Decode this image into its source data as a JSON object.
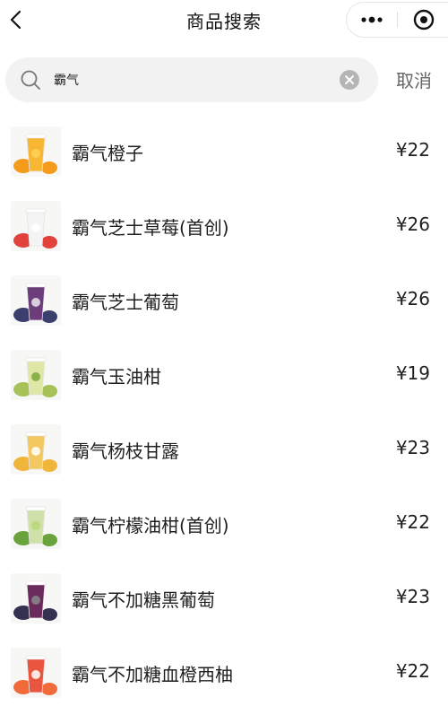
{
  "header": {
    "title": "商品搜索"
  },
  "search": {
    "value": "霸气",
    "cancel_label": "取消"
  },
  "products": [
    {
      "name": "霸气橙子",
      "price": "¥22",
      "cup": "#f7b733",
      "fruit": "#f59b1b",
      "fruit2": "#ffd35a"
    },
    {
      "name": "霸气芝士草莓(首创)",
      "price": "¥26",
      "cup": "#f4f4f4",
      "fruit": "#e2423b",
      "fruit2": "#ffffff"
    },
    {
      "name": "霸气芝士葡萄",
      "price": "¥26",
      "cup": "#6c3d7a",
      "fruit": "#3b3f6e",
      "fruit2": "#eae6ef"
    },
    {
      "name": "霸气玉油柑",
      "price": "¥19",
      "cup": "#dfe6a6",
      "fruit": "#a8c25a",
      "fruit2": "#7aa83a"
    },
    {
      "name": "霸气杨枝甘露",
      "price": "¥23",
      "cup": "#f3c860",
      "fruit": "#f0b53b",
      "fruit2": "#ffffff"
    },
    {
      "name": "霸气柠檬油柑(首创)",
      "price": "¥22",
      "cup": "#cfe0a8",
      "fruit": "#6aa33b",
      "fruit2": "#b9d67a"
    },
    {
      "name": "霸气不加糖黑葡萄",
      "price": "¥23",
      "cup": "#6b2a5c",
      "fruit": "#34304f",
      "fruit2": "#8a8a8a"
    },
    {
      "name": "霸气不加糖血橙西柚",
      "price": "¥22",
      "cup": "#e9553e",
      "fruit": "#f06a3a",
      "fruit2": "#ffffff"
    }
  ],
  "icons": {
    "back": "chevron-left-icon",
    "more": "more-dots-icon",
    "target": "target-icon",
    "search": "search-icon",
    "clear": "clear-icon"
  }
}
